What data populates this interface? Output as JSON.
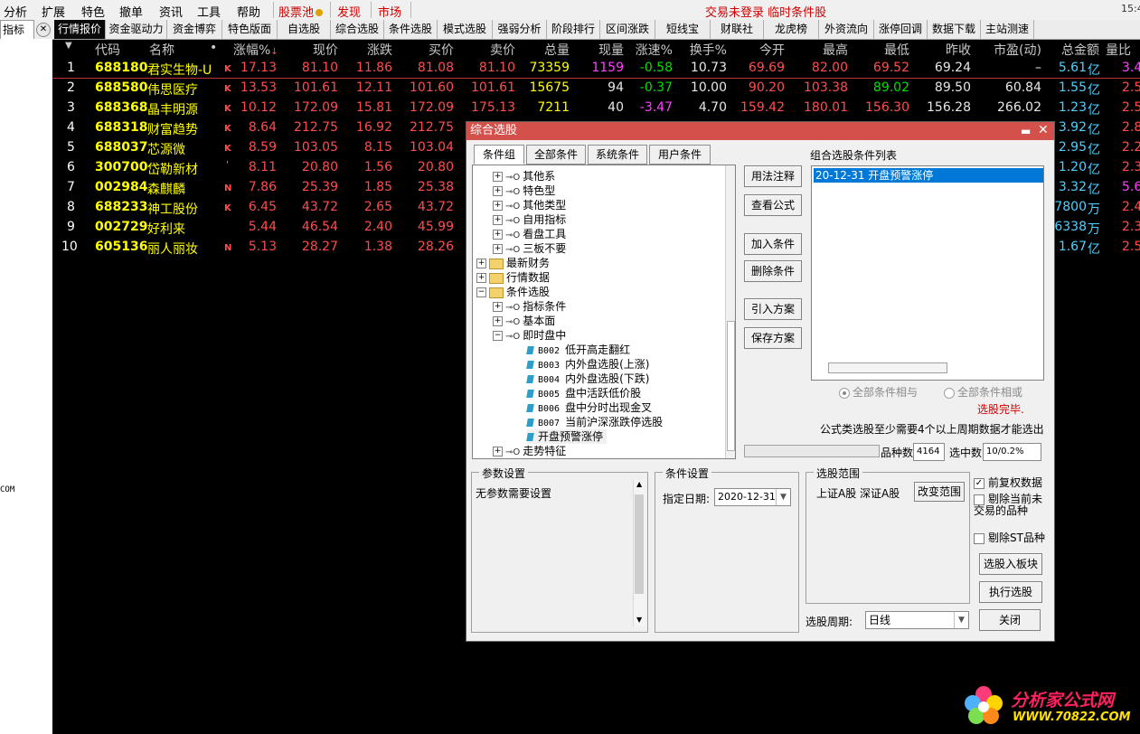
{
  "menubar": {
    "items": [
      "分析",
      "扩展",
      "特色",
      "撤单",
      "资讯",
      "工具",
      "帮助"
    ],
    "stockpool": "股票池",
    "discover": "发现",
    "market": "市场",
    "status": "交易未登录 临时条件股",
    "time": "15:4"
  },
  "tabbar": {
    "left_label": "指标",
    "tabs": [
      "行情报价",
      "资金驱动力",
      "资金博弈",
      "特色版面",
      "自选股",
      "综合选股",
      "条件选股",
      "模式选股",
      "强弱分析",
      "阶段排行",
      "区间涨跌",
      "短线宝",
      "财联社",
      "龙虎榜",
      "外资流向",
      "涨停回调",
      "数据下载",
      "主站测速"
    ]
  },
  "quote": {
    "headers": [
      "代码",
      "名称",
      "•",
      "涨幅%",
      "现价",
      "涨跌",
      "买价",
      "卖价",
      "总量",
      "现量",
      "涨速%",
      "换手%",
      "今开",
      "最高",
      "最低",
      "昨收",
      "市盈(动)",
      "总金额",
      "量比"
    ],
    "rows": [
      {
        "idx": "1",
        "code": "688180",
        "name": "君实生物-U",
        "mark": "K",
        "pct": "17.13",
        "price": "81.10",
        "chg": "11.86",
        "bid": "81.08",
        "ask": "81.10",
        "vol": "73359",
        "cur": "1159",
        "speed": "-0.58",
        "turn": "10.73",
        "open": "69.69",
        "high": "82.00",
        "low": "69.52",
        "prev": "69.24",
        "pe": "–",
        "amt": "5.61",
        "unit": "亿",
        "lb": "3.4"
      },
      {
        "idx": "2",
        "code": "688580",
        "name": "伟思医疗",
        "mark": "K",
        "pct": "13.53",
        "price": "101.61",
        "chg": "12.11",
        "bid": "101.60",
        "ask": "101.61",
        "vol": "15675",
        "cur": "94",
        "speed": "-0.37",
        "turn": "10.00",
        "open": "90.20",
        "high": "103.38",
        "low": "89.02",
        "prev": "89.50",
        "pe": "60.84",
        "amt": "1.55",
        "unit": "亿",
        "lb": "2.5"
      },
      {
        "idx": "3",
        "code": "688368",
        "name": "晶丰明源",
        "mark": "K",
        "pct": "10.12",
        "price": "172.09",
        "chg": "15.81",
        "bid": "172.09",
        "ask": "175.13",
        "vol": "7211",
        "cur": "40",
        "speed": "-3.47",
        "turn": "4.70",
        "open": "159.42",
        "high": "180.01",
        "low": "156.30",
        "prev": "156.28",
        "pe": "266.02",
        "amt": "1.23",
        "unit": "亿",
        "lb": "2.5"
      },
      {
        "idx": "4",
        "code": "688318",
        "name": "财富趋势",
        "mark": "K",
        "pct": "8.64",
        "price": "212.75",
        "chg": "16.92",
        "bid": "212.75",
        "amt": "3.92",
        "unit": "亿",
        "lb": "2.8"
      },
      {
        "idx": "5",
        "code": "688037",
        "name": "芯源微",
        "mark": "K",
        "pct": "8.59",
        "price": "103.05",
        "chg": "8.15",
        "bid": "103.04",
        "amt": "2.95",
        "unit": "亿",
        "lb": "2.2"
      },
      {
        "idx": "6",
        "code": "300700",
        "name": "岱勒新材",
        "mark": "'",
        "pct": "8.11",
        "price": "20.80",
        "chg": "1.56",
        "bid": "20.80",
        "amt": "1.20",
        "unit": "亿",
        "lb": "2.3"
      },
      {
        "idx": "7",
        "code": "002984",
        "name": "森麒麟",
        "mark": "N",
        "pct": "7.86",
        "price": "25.39",
        "chg": "1.85",
        "bid": "25.38",
        "amt": "3.32",
        "unit": "亿",
        "lb": "5.6"
      },
      {
        "idx": "8",
        "code": "688233",
        "name": "神工股份",
        "mark": "K",
        "pct": "6.45",
        "price": "43.72",
        "chg": "2.65",
        "bid": "43.72",
        "amt": "7800",
        "unit": "万",
        "lb": "2.4"
      },
      {
        "idx": "9",
        "code": "002729",
        "name": "好利来",
        "mark": "",
        "pct": "5.44",
        "price": "46.54",
        "chg": "2.40",
        "bid": "45.99",
        "amt": "6338",
        "unit": "万",
        "lb": "2.3"
      },
      {
        "idx": "10",
        "code": "605136",
        "name": "丽人丽妆",
        "mark": "N",
        "pct": "5.13",
        "price": "28.27",
        "chg": "1.38",
        "bid": "28.26",
        "amt": "1.67",
        "unit": "亿",
        "lb": "2.5"
      }
    ]
  },
  "leftstrip": {
    "com": "COM"
  },
  "dialog": {
    "title": "综合选股",
    "tabs": [
      "条件组",
      "全部条件",
      "系统条件",
      "用户条件"
    ],
    "tree": [
      "其他系",
      "特色型",
      "其他类型",
      "自用指标",
      "看盘工具",
      "三板不要",
      "最新财务",
      "行情数据",
      "条件选股",
      "指标条件",
      "基本面",
      "即时盘中",
      "低开高走翻红",
      "内外盘选股(上涨)",
      "内外盘选股(下跌)",
      "盘中活跃低价股",
      "盘中分时出现金叉",
      "当前沪深涨跌停选股",
      "开盘预警涨停",
      "走势特征"
    ],
    "tree_codes": [
      "B002",
      "B003",
      "B004",
      "B005",
      "B006",
      "B007"
    ],
    "buttons": [
      "用法注释",
      "查看公式",
      "加入条件",
      "删除条件",
      "引入方案",
      "保存方案"
    ],
    "list_title": "组合选股条件列表",
    "list_item": "20-12-31 开盘预警涨停",
    "radio_and": "全部条件相与",
    "radio_or": "全部条件相或",
    "done": "选股完毕.",
    "note": "公式类选股至少需要4个以上周期数据才能选出",
    "count_label": "品种数",
    "count": "4164",
    "selected_label": "选中数",
    "selected": "10/0.2%",
    "param_caption": "参数设置",
    "param_text": "无参数需要设置",
    "cond_caption": "条件设置",
    "date_label": "指定日期:",
    "date": "2020-12-31",
    "range_caption": "选股范围",
    "range_text": "上证A股 深证A股",
    "range_btn": "改变范围",
    "chk1": "前复权数据",
    "chk2": "剔除当前未交易的品种",
    "chk3": "剔除ST品种",
    "btn_block": "选股入板块",
    "btn_exec": "执行选股",
    "period_label": "选股周期:",
    "period": "日线",
    "close": "关闭"
  },
  "watermark": {
    "t1": "分析家公式网",
    "t2": "WWW.70822.COM"
  },
  "colors": {
    "up": "#ff4d4d",
    "down": "#00e000",
    "code": "#ffff00",
    "amount": "#4fd0ff",
    "title_bar": "#d4504a",
    "selected": "#0078d7"
  }
}
